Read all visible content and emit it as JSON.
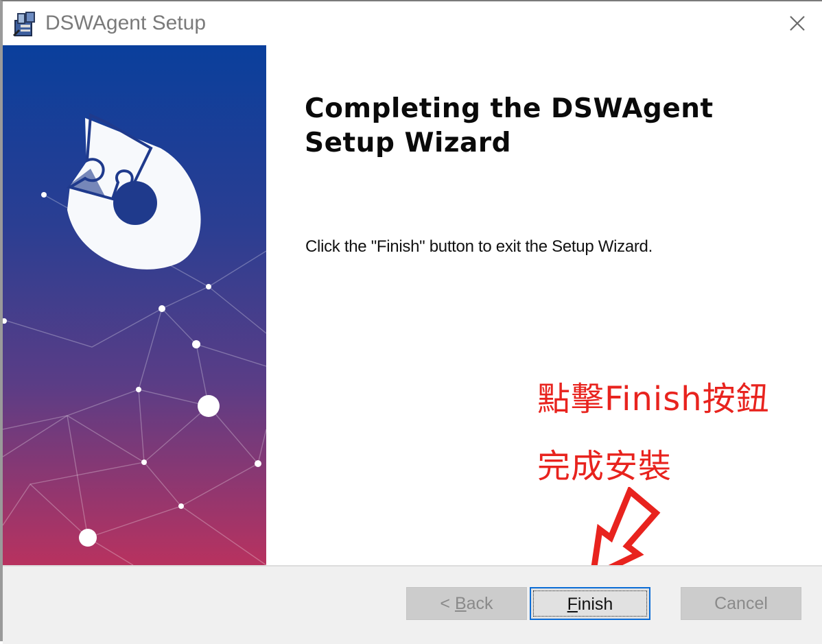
{
  "window": {
    "title": "DSWAgent Setup",
    "icon": "installer-package-icon",
    "close_icon": "close-icon"
  },
  "main": {
    "heading": "Completing the DSWAgent Setup Wizard",
    "message": "Click the \"Finish\" button to exit the Setup Wizard."
  },
  "annotation": {
    "line1": "點擊Finish按鈕",
    "line2": "完成安裝",
    "color": "#e8231e",
    "arrow_icon": "arrow-down-left-icon"
  },
  "footer": {
    "back": {
      "prefix": "< ",
      "accel": "B",
      "rest": "ack",
      "enabled": false
    },
    "finish": {
      "accel": "F",
      "rest": "inish",
      "enabled": true,
      "focused": true
    },
    "cancel": {
      "label": "Cancel",
      "enabled": false
    }
  },
  "colors": {
    "side_panel_top": "#0a3f9c",
    "side_panel_bottom": "#b8325f",
    "focus_border": "#0a6cd6"
  }
}
